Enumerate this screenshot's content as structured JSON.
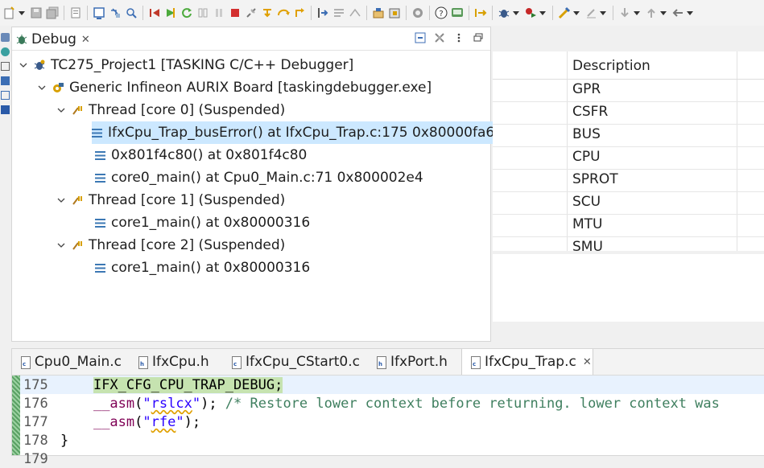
{
  "toolbar": {
    "icons": [
      "new-icon",
      "save-icon",
      "save-all-icon",
      "separator",
      "print-icon",
      "build-icon",
      "debug-config-icon",
      "skip-breakpoints-icon",
      "resume-icon",
      "suspend-icon",
      "pause-icon",
      "terminate-icon",
      "disconnect-icon",
      "step-into-icon",
      "step-over-icon",
      "step-return-icon",
      "instruction-step-icon",
      "use-step-filters-icon",
      "drop-to-frame-icon",
      "target-icon",
      "stop-target-icon",
      "help-icon",
      "console-icon",
      "next-annotation-icon",
      "debug-icon",
      "run-icon",
      "external-tools-icon",
      "pin-icon",
      "navigate-down-icon",
      "navigate-up-icon",
      "back-icon"
    ]
  },
  "debug_view": {
    "tab_label": "Debug",
    "tree": [
      {
        "label": "TC275_Project1 [TASKING C/C++ Debugger]",
        "level": 0,
        "kind": "launch"
      },
      {
        "label": "Generic Infineon AURIX Board [taskingdebugger.exe]",
        "level": 1,
        "kind": "target"
      },
      {
        "label": "Thread [core 0] (Suspended)",
        "level": 2,
        "kind": "thread"
      },
      {
        "label": "IfxCpu_Trap_busError() at IfxCpu_Trap.c:175 0x80000fa6",
        "level": 3,
        "kind": "frame",
        "selected": true
      },
      {
        "label": "0x801f4c80() at 0x801f4c80",
        "level": 3,
        "kind": "frame"
      },
      {
        "label": "core0_main() at Cpu0_Main.c:71 0x800002e4",
        "level": 3,
        "kind": "frame"
      },
      {
        "label": "Thread [core 1] (Suspended)",
        "level": 2,
        "kind": "thread"
      },
      {
        "label": "core1_main() at 0x80000316",
        "level": 3,
        "kind": "frame"
      },
      {
        "label": "Thread [core 2] (Suspended)",
        "level": 2,
        "kind": "thread"
      },
      {
        "label": "core1_main() at 0x80000316",
        "level": 3,
        "kind": "frame"
      }
    ]
  },
  "registers": {
    "column_header": "Description",
    "rows": [
      "GPR",
      "CSFR",
      "BUS",
      "CPU",
      "SPROT",
      "SCU",
      "MTU",
      "SMU"
    ]
  },
  "editor": {
    "tabs": [
      {
        "label": "Cpu0_Main.c",
        "active": false
      },
      {
        "label": "IfxCpu.h",
        "active": false
      },
      {
        "label": "IfxCpu_CStart0.c",
        "active": false
      },
      {
        "label": "IfxPort.h",
        "active": false
      },
      {
        "label": "IfxCpu_Trap.c",
        "active": true
      }
    ],
    "lines": [
      {
        "num": "175",
        "text": "    IFX_CFG_CPU_TRAP_DEBUG;"
      },
      {
        "num": "176",
        "text": "    __asm(\"rslcx\"); /* Restore lower context before returning. lower context was"
      },
      {
        "num": "177",
        "text": "    __asm(\"rfe\");"
      },
      {
        "num": "178",
        "text": "}"
      },
      {
        "num": "179",
        "text": ""
      }
    ]
  },
  "colors": {
    "selection": "#cce8ff",
    "current_line_highlight": "#c6e3b0",
    "keyword": "#7f0055",
    "string": "#2a00ff",
    "comment": "#3f7f5f"
  }
}
